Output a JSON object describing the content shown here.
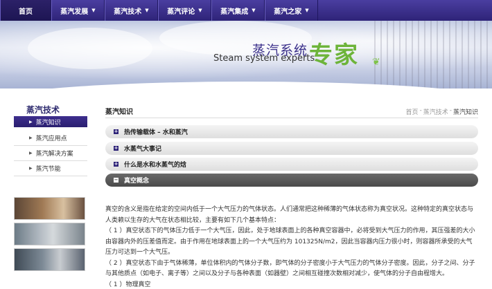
{
  "nav": {
    "items": [
      {
        "label": "首页",
        "dropdown": false,
        "active": true
      },
      {
        "label": "蒸汽发展",
        "dropdown": true
      },
      {
        "label": "蒸汽技术",
        "dropdown": true
      },
      {
        "label": "蒸汽评论",
        "dropdown": true
      },
      {
        "label": "蒸汽集成",
        "dropdown": true
      },
      {
        "label": "蒸汽之家",
        "dropdown": true
      }
    ],
    "arrow": "▼"
  },
  "banner": {
    "brand_cn": "蒸汽系统",
    "brand_en": "Steam system experts",
    "brand_big": "专家",
    "leaf": "leaf-icon"
  },
  "sidebar": {
    "title": "蒸汽技术",
    "items": [
      {
        "label": "蒸汽知识",
        "active": true
      },
      {
        "label": "蒸汽应用点"
      },
      {
        "label": "蒸汽解决方案"
      },
      {
        "label": "蒸汽节能"
      }
    ],
    "bullet": "▶"
  },
  "main": {
    "title": "蒸汽知识",
    "breadcrumb": {
      "home": "首页",
      "sep": "-",
      "section": "蒸汽技术",
      "current": "蒸汽知识"
    },
    "accordion": [
      {
        "label": "热传输载体 – 水和蒸汽",
        "marker": "+"
      },
      {
        "label": "水蒸气大事记",
        "marker": "+"
      },
      {
        "label": "什么是水和水蒸气的焓",
        "marker": "+"
      },
      {
        "label": "真空概念",
        "marker": "−",
        "open": true
      }
    ],
    "paragraphs": [
      "真空的含义是指在给定的空间内低于一个大气压力的气体状态。人们通常把这种稀薄的气体状态称为真空状况。这种特定的真空状态与人类赖以生存的大气在状态相比较，主要有如下几个基本特点：",
      "（ 1 ）真空状态下的气体压力低于一个大气压，因此，处于地球表面上的各种真空容器中，必将受到大气压力的作用，其压强差的大小由容器内外的压差值而定。由于作用在地球表面上的一个大气压约为 101325N/m2，因此当容器内压力很小时，则容器所承受的大气压力可达到一个大气压。",
      "（ 2 ）真空状态下由于气体稀薄，单位体积内的气体分子数，即气体的分子密度小于大气压力的气体分子密度。因此，分子之间、分子与其他质点（如电子、离子等）之间以及分子与各种表面（如器壁）之间相互碰撞次数相对减少，使气体的分子自由程增大。",
      "（ 1 ）物理真空"
    ]
  }
}
